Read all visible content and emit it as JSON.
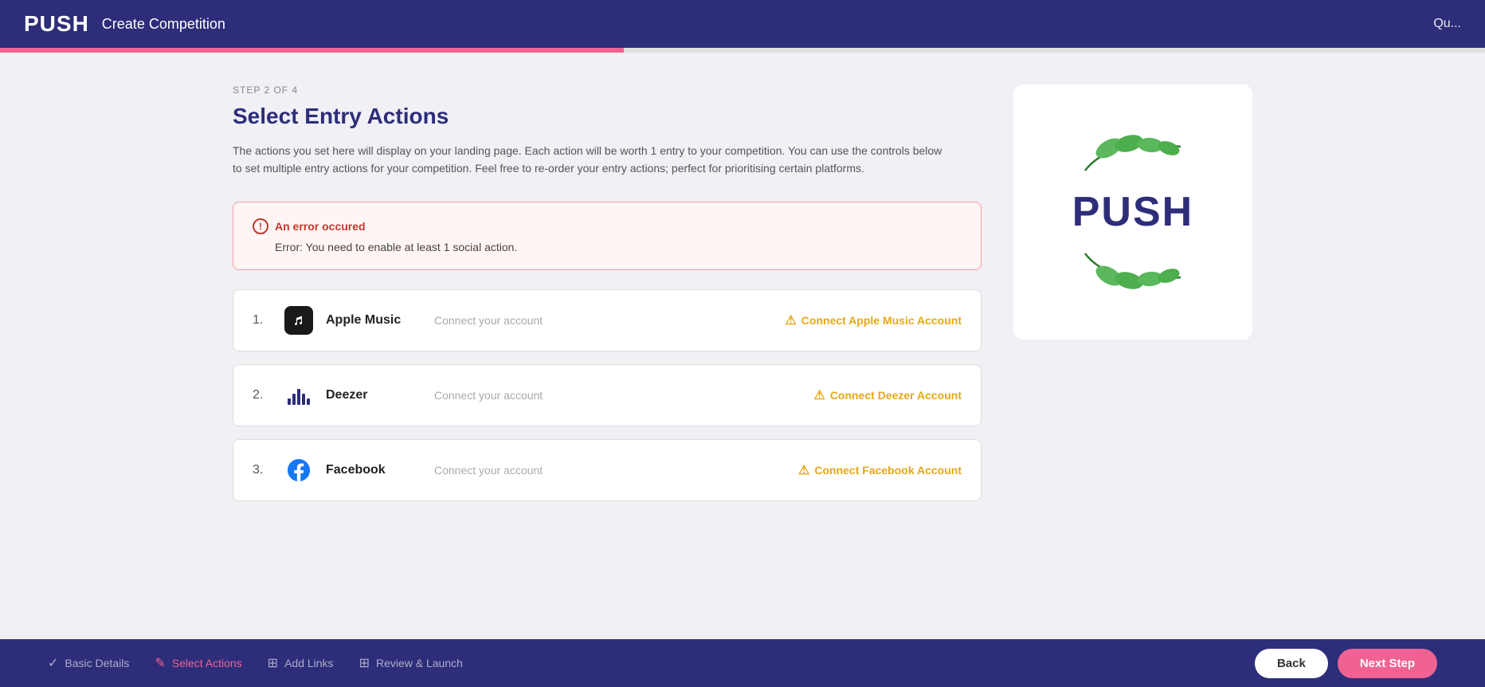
{
  "header": {
    "logo": "PUSH",
    "title": "Create Competition",
    "quit_label": "Qu..."
  },
  "progress": {
    "fill_percent": "42%"
  },
  "step": {
    "indicator": "STEP 2 OF 4",
    "title": "Select Entry Actions",
    "description": "The actions you set here will display on your landing page. Each action will be worth 1 entry to your competition. You can use the controls below to set multiple entry actions for your competition. Feel free to re-order your entry actions; perfect for prioritising certain platforms."
  },
  "error": {
    "title": "An error occured",
    "message": "Error: You need to enable at least 1 social action."
  },
  "actions": [
    {
      "number": "1.",
      "name": "Apple Music",
      "subtitle": "Connect your account",
      "connect_label": "Connect Apple Music Account",
      "icon_type": "apple-music"
    },
    {
      "number": "2.",
      "name": "Deezer",
      "subtitle": "Connect your account",
      "connect_label": "Connect Deezer Account",
      "icon_type": "deezer"
    },
    {
      "number": "3.",
      "name": "Facebook",
      "subtitle": "Connect your account",
      "connect_label": "Connect Facebook Account",
      "icon_type": "facebook"
    }
  ],
  "footer": {
    "steps": [
      {
        "label": "Basic Details",
        "icon": "✓",
        "active": false
      },
      {
        "label": "Select Actions",
        "icon": "✎",
        "active": true
      },
      {
        "label": "Add Links",
        "icon": "⊞",
        "active": false
      },
      {
        "label": "Review & Launch",
        "icon": "⊞",
        "active": false
      }
    ],
    "back_label": "Back",
    "next_label": "Next Step"
  }
}
